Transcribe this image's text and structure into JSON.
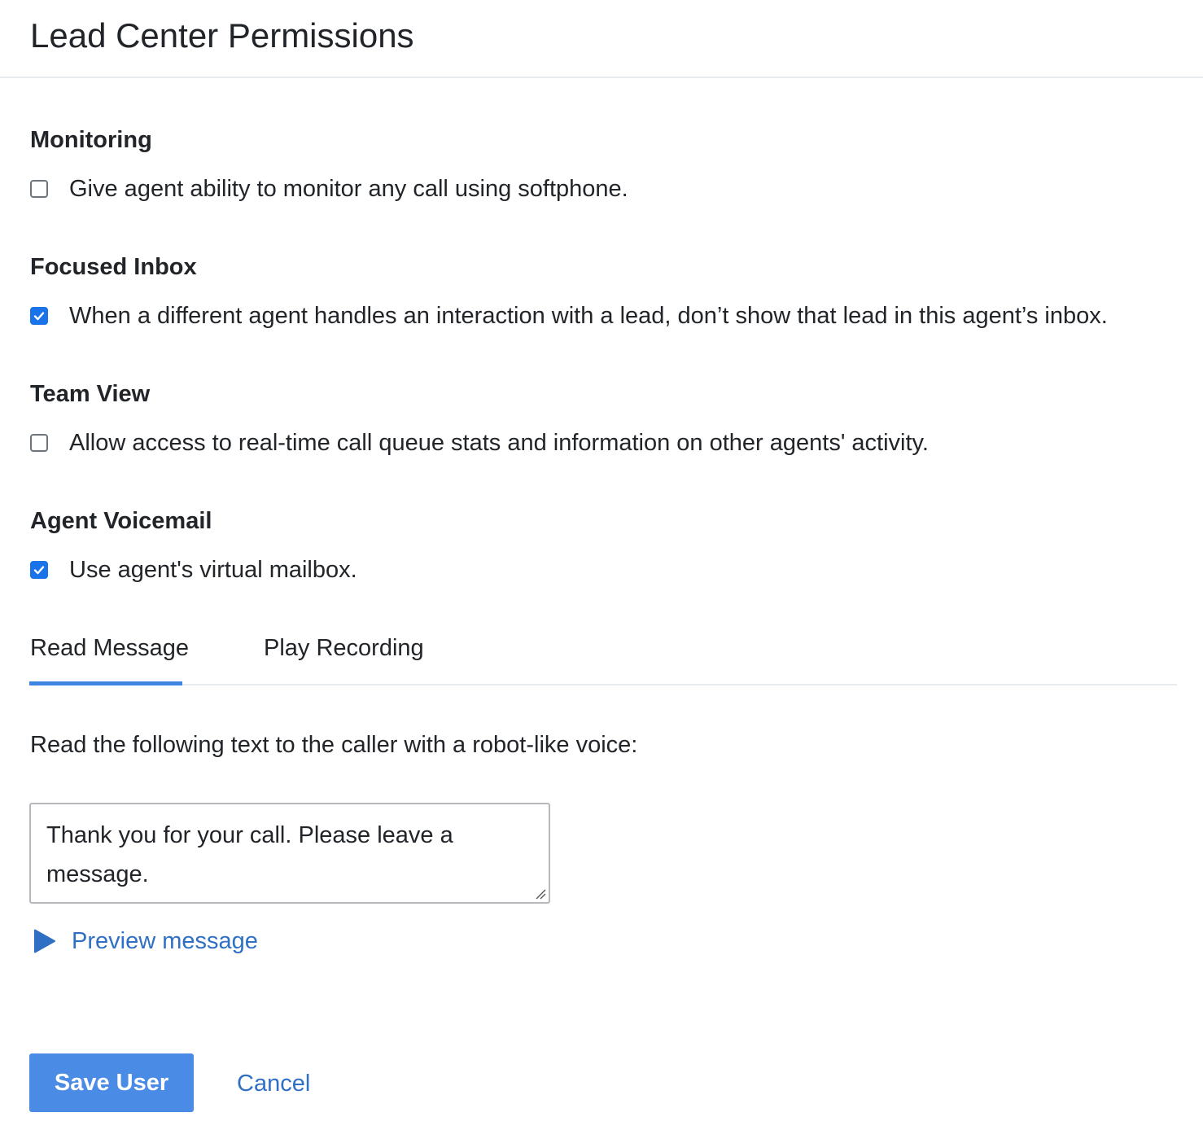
{
  "header": {
    "title": "Lead Center Permissions"
  },
  "sections": [
    {
      "heading": "Monitoring",
      "option_label": "Give agent ability to monitor any call using softphone.",
      "checked": false
    },
    {
      "heading": "Focused Inbox",
      "option_label": "When a different agent handles an interaction with a lead, don’t show that lead in this agent’s inbox.",
      "checked": true
    },
    {
      "heading": "Team View",
      "option_label": "Allow access to real-time call queue stats and information on other agents' activity.",
      "checked": false
    },
    {
      "heading": "Agent Voicemail",
      "option_label": "Use agent's virtual mailbox.",
      "checked": true
    }
  ],
  "voicemail_tabs": {
    "items": [
      {
        "label": "Read Message",
        "active": true
      },
      {
        "label": "Play Recording",
        "active": false
      }
    ]
  },
  "read_message": {
    "instruction": "Read the following text to the caller with a robot-like voice:",
    "message_value": "Thank you for your call. Please leave a message.",
    "preview_label": "Preview message"
  },
  "actions": {
    "save_label": "Save User",
    "cancel_label": "Cancel"
  },
  "colors": {
    "accent": "#1a73e8",
    "tab_indicator": "#3d85e0",
    "link": "#2f6fc4",
    "primary_button": "#4a8be6"
  },
  "icons": {
    "checkbox_checked": "check-icon",
    "preview": "play-icon",
    "textarea_resize": "resize-grip-icon"
  }
}
